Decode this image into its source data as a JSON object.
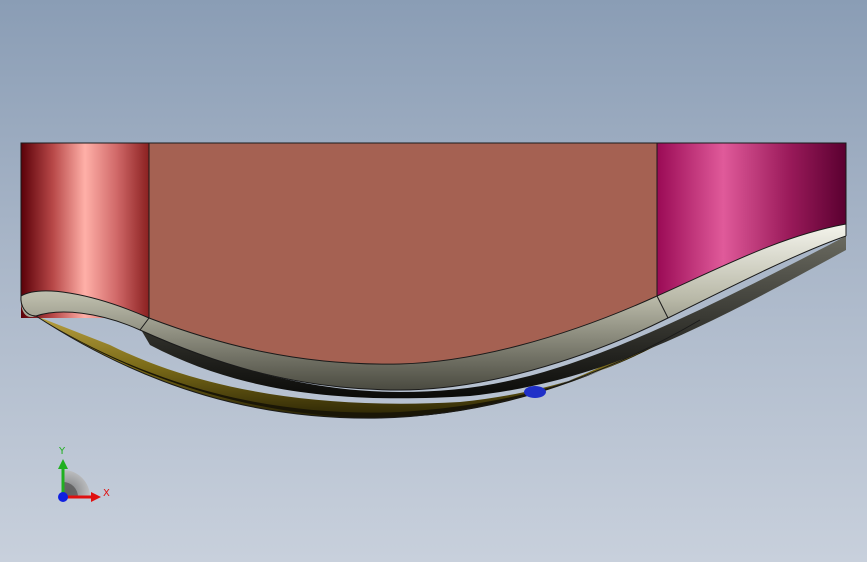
{
  "viewport": {
    "background_top": "#8a9db5",
    "background_bottom": "#c8d0dc"
  },
  "model": {
    "left_face_color": "#c8585a",
    "center_face_color": "#a56152",
    "right_face_color": "#b82e72",
    "bottom_face_color": "#9c8a2a",
    "edge_band_color": "#c9cab8"
  },
  "triad": {
    "x_label": "X",
    "y_label": "Y",
    "x_color": "#e01010",
    "y_color": "#20b020",
    "z_color": "#1020e0"
  }
}
